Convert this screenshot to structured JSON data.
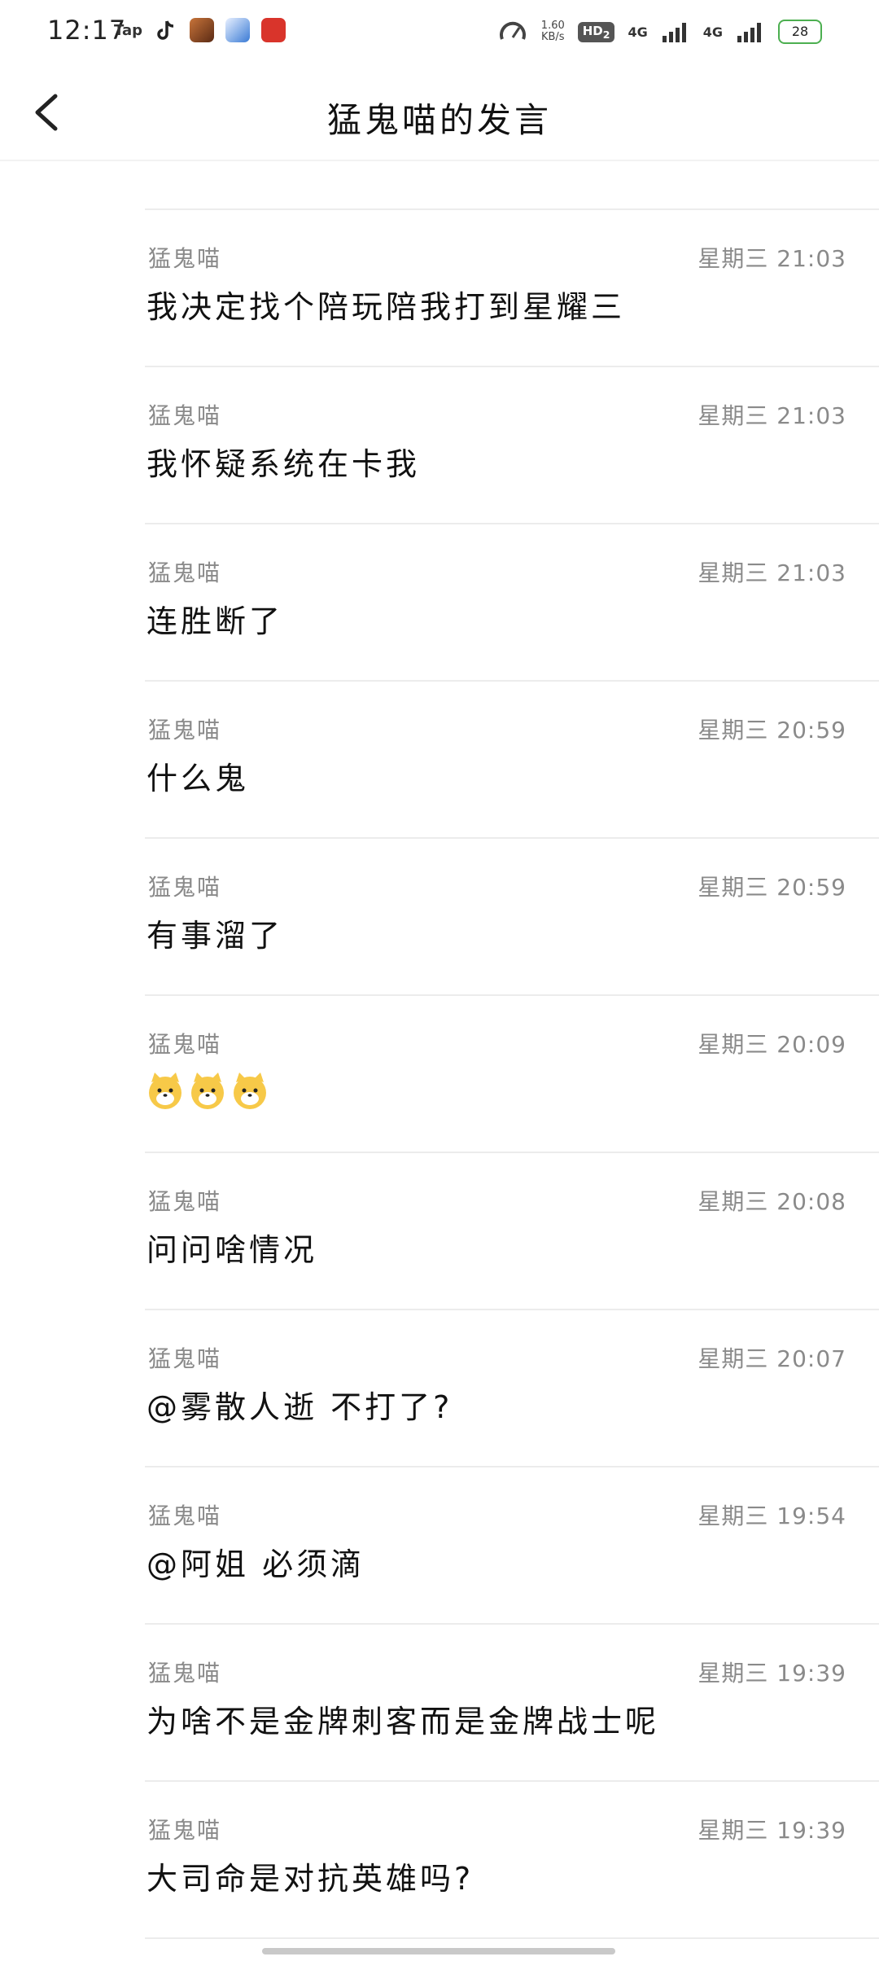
{
  "status_bar": {
    "time": "12:17",
    "tap_label": "Tap",
    "net_speed_value": "1.60",
    "net_speed_unit": "KB/s",
    "hd_label": "HD",
    "hd_sub": "2",
    "signal1": "4G",
    "signal2": "4G",
    "battery": "28",
    "icon_names": [
      "tiktok-icon",
      "game-avatar-icon",
      "browser-icon",
      "zhui-app-icon"
    ]
  },
  "nav": {
    "title": "猛鬼喵的发言"
  },
  "messages": [
    {
      "author": "猛鬼喵",
      "time": "星期三 21:03",
      "text": "我决定找个陪玩陪我打到星耀三"
    },
    {
      "author": "猛鬼喵",
      "time": "星期三 21:03",
      "text": "我怀疑系统在卡我"
    },
    {
      "author": "猛鬼喵",
      "time": "星期三 21:03",
      "text": "连胜断了"
    },
    {
      "author": "猛鬼喵",
      "time": "星期三 20:59",
      "text": "什么鬼"
    },
    {
      "author": "猛鬼喵",
      "time": "星期三 20:59",
      "text": "有事溜了"
    },
    {
      "author": "猛鬼喵",
      "time": "星期三 20:09",
      "text": "",
      "emoji": [
        "cat-emoji",
        "cat-emoji",
        "cat-emoji"
      ]
    },
    {
      "author": "猛鬼喵",
      "time": "星期三 20:08",
      "text": "问问啥情况"
    },
    {
      "author": "猛鬼喵",
      "time": "星期三 20:07",
      "text": "@雾散人逝 不打了?"
    },
    {
      "author": "猛鬼喵",
      "time": "星期三 19:54",
      "text": "@阿姐 必须滴"
    },
    {
      "author": "猛鬼喵",
      "time": "星期三 19:39",
      "text": "为啥不是金牌刺客而是金牌战士呢"
    },
    {
      "author": "猛鬼喵",
      "time": "星期三 19:39",
      "text": "大司命是对抗英雄吗?"
    }
  ]
}
